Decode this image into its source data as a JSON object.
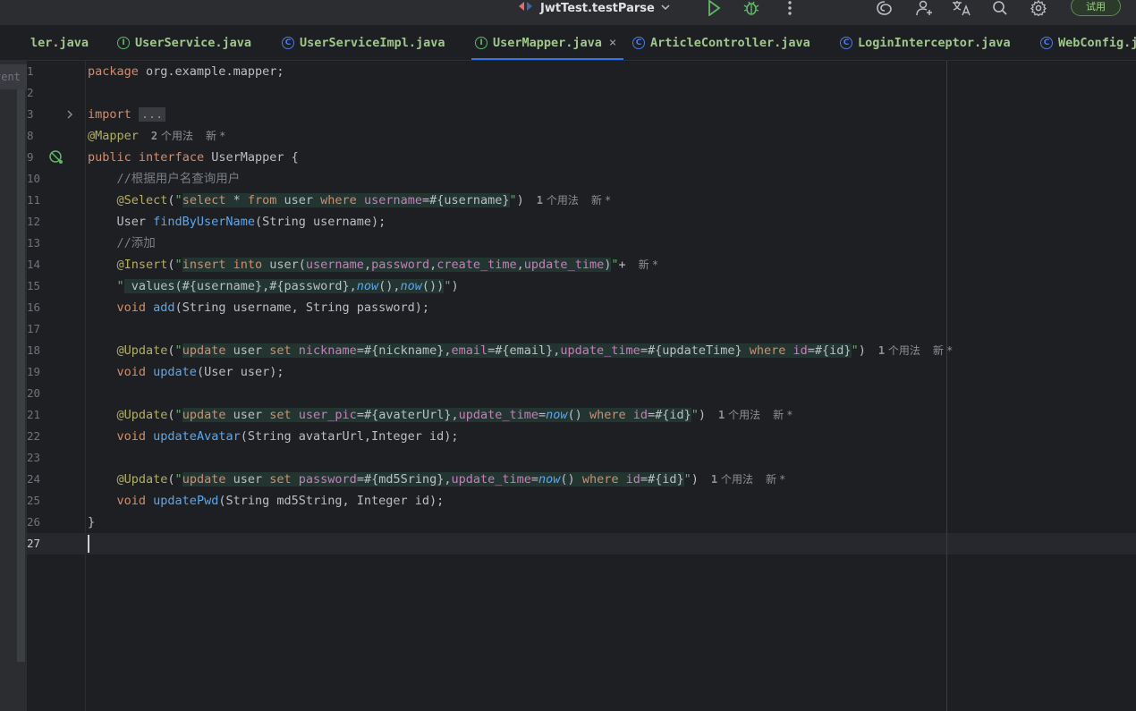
{
  "toolbar": {
    "run_config": "JwtTest.testParse",
    "trial_label": "试用"
  },
  "tabs": [
    {
      "label": "ler.java",
      "kind": "none"
    },
    {
      "label": "UserService.java",
      "kind": "interface",
      "glyph": "I"
    },
    {
      "label": "UserServiceImpl.java",
      "kind": "class",
      "glyph": "C"
    },
    {
      "label": "UserMapper.java",
      "kind": "interface",
      "glyph": "I",
      "active": true,
      "close": "×"
    },
    {
      "label": "ArticleController.java",
      "kind": "class",
      "glyph": "C"
    },
    {
      "label": "LoginInterceptor.java",
      "kind": "class",
      "glyph": "C"
    },
    {
      "label": "WebConfig.j",
      "kind": "class",
      "glyph": "C"
    }
  ],
  "left_panel_label": "vent",
  "line_numbers": [
    "1",
    "2",
    "3",
    "8",
    "9",
    "10",
    "11",
    "12",
    "13",
    "14",
    "15",
    "16",
    "17",
    "18",
    "19",
    "20",
    "21",
    "22",
    "23",
    "24",
    "25",
    "26",
    "27"
  ],
  "code": {
    "l1_kw": "package",
    "l1_rest": " org.example.mapper;",
    "l3_kw": "import",
    "l3_fold": "...",
    "l8_ann": "@Mapper",
    "l8_hint_n": "2",
    "l8_hint_txt": " 个用法",
    "hint_new": "新 *",
    "l9_kw1": "public",
    "l9_kw2": "interface",
    "l9_rest": " UserMapper {",
    "l10_cmt": "    //根据用户名查询用户",
    "l11_ann": "    @Select",
    "l11_q1": "\"",
    "l11_s1": "select",
    "l11_s2": " * ",
    "l11_s3": "from",
    "l11_s4": " user ",
    "l11_s5": "where",
    "l11_s6": " ",
    "l11_s7": "username",
    "l11_s8": "=#{username}",
    "l11_q2": "\"",
    "l11_end": ")",
    "l11_hint_n": "1",
    "l11_hint_txt": " 个用法",
    "l12_a": "    User ",
    "l12_fn": "findByUserName",
    "l12_b": "(String username);",
    "l13_cmt": "    //添加",
    "l14_ann": "    @Insert",
    "l14_s1": "insert",
    "l14_s2": "into",
    "l14_s3": "user(",
    "l14_s4": "username",
    "l14_s5": "password",
    "l14_s6": "create_time",
    "l14_s7": "update_time",
    "l14_end": "+",
    "l15_s1": " values(#{username},#{password},",
    "l15_now1": "now",
    "l15_mid": "(),",
    "l15_now2": "now",
    "l15_s2": "())",
    "l15_end": ")",
    "l16_kw": "    void",
    "l16_fn": "add",
    "l16_rest": "(String username, String password);",
    "l18_ann": "    @Update",
    "l18_s1": "update",
    "l18_s2": " user ",
    "l18_s3": "set",
    "l18_s4": "nickname",
    "l18_s5": "=#{nickname},",
    "l18_s6": "email",
    "l18_s7": "=#{email},",
    "l18_s8": "update_time",
    "l18_s9": "=#{updateTime} ",
    "l18_s10": "where",
    "l18_s11": "id",
    "l18_s12": "=#{id}",
    "l18_hint_n": "1",
    "l18_hint_txt": " 个用法",
    "l19_kw": "    void",
    "l19_fn": "update",
    "l19_rest": "(User user);",
    "l21_ann": "    @Update",
    "l21_s1": "update",
    "l21_s2": " user ",
    "l21_s3": "set",
    "l21_s4": "user_pic",
    "l21_s5": "=#{avaterUrl},",
    "l21_s6": "update_time",
    "l21_s7": "=",
    "l21_now": "now",
    "l21_s8": "() ",
    "l21_s9": "where",
    "l21_s10": "id",
    "l21_s11": "=#{id}",
    "l21_hint_n": "1",
    "l21_hint_txt": " 个用法",
    "l22_kw": "    void",
    "l22_fn": "updateAvatar",
    "l22_rest": "(String avatarUrl,Integer id);",
    "l24_ann": "    @Update",
    "l24_s1": "update",
    "l24_s2": " user ",
    "l24_s3": "set",
    "l24_s4": "password",
    "l24_s5": "=#{md5Sring},",
    "l24_s6": "update_time",
    "l24_s7": "=",
    "l24_now": "now",
    "l24_s8": "() ",
    "l24_s9": "where",
    "l24_s10": "id",
    "l24_s11": "=#{id}",
    "l24_hint_n": "1",
    "l24_hint_txt": " 个用法",
    "l25_kw": "    void",
    "l25_fn": "updatePwd",
    "l25_rest": "(String md5String, Integer id);",
    "l26": "}"
  }
}
